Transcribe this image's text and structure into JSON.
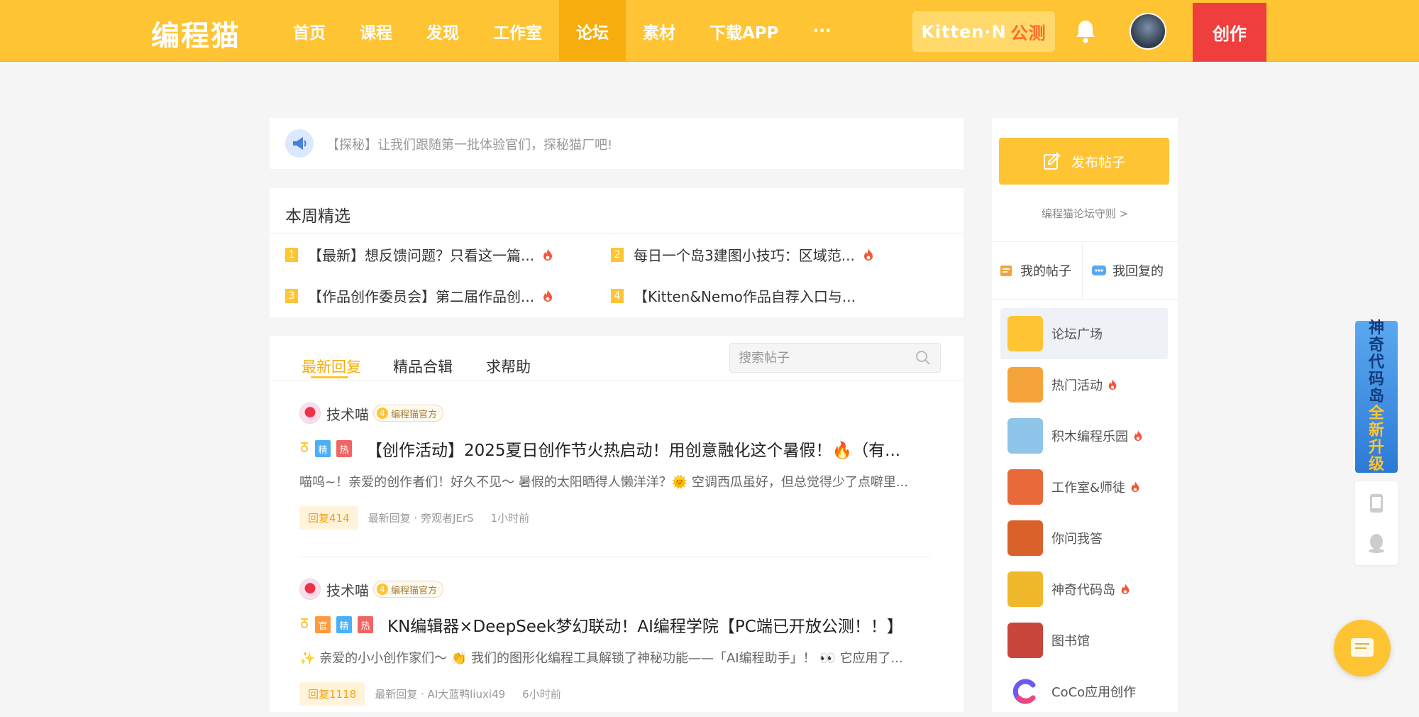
{
  "header": {
    "logo": "编程猫",
    "nav": [
      {
        "label": "首页",
        "active": false
      },
      {
        "label": "课程",
        "active": false
      },
      {
        "label": "发现",
        "active": false
      },
      {
        "label": "工作室",
        "active": false
      },
      {
        "label": "论坛",
        "active": true
      },
      {
        "label": "素材",
        "active": false
      },
      {
        "label": "下载APP",
        "active": false
      },
      {
        "label": "···",
        "active": false
      }
    ],
    "kitten_label": "Kitten·N",
    "kitten_suffix": "公测",
    "create_label": "创作",
    "brand_color": "#fec433",
    "create_color": "#ee3e3e"
  },
  "notice": {
    "text": "【探秘】让我们跟随第一批体验官们，探秘猫厂吧!"
  },
  "weekly": {
    "title": "本周精选",
    "items": [
      {
        "num": "1",
        "text": "【最新】想反馈问题？只看这一篇...",
        "hot": true
      },
      {
        "num": "2",
        "text": "每日一个岛3建图小技巧：区域范...",
        "hot": true
      },
      {
        "num": "3",
        "text": "【作品创作委员会】第二届作品创...",
        "hot": true
      },
      {
        "num": "4",
        "text": "【Kitten&Nemo作品自荐入口与...",
        "hot": false
      }
    ]
  },
  "feed": {
    "tabs": [
      {
        "label": "最新回复",
        "active": true
      },
      {
        "label": "精品合辑",
        "active": false
      },
      {
        "label": "求帮助",
        "active": false
      }
    ],
    "search_placeholder": "搜索帖子",
    "posts": [
      {
        "author": "技术喵",
        "level": "4",
        "badge": "编程猫官方",
        "tags": [
          {
            "label": "精",
            "kind": "jing"
          },
          {
            "label": "热",
            "kind": "re"
          }
        ],
        "title": "【创作活动】2025夏日创作节火热启动！用创意融化这个暑假！🔥（有...",
        "excerpt": "喵呜~！亲爱的创作者们！好久不见～ 暑假的太阳晒得人懒洋洋？🌞 空调西瓜虽好，但总觉得少了点噼里...",
        "reply": "回复414",
        "last_reply": "最新回复 · 旁观者JErS",
        "time": "1小时前"
      },
      {
        "author": "技术喵",
        "level": "4",
        "badge": "编程猫官方",
        "tags": [
          {
            "label": "官",
            "kind": "guan"
          },
          {
            "label": "精",
            "kind": "jing"
          },
          {
            "label": "热",
            "kind": "re"
          }
        ],
        "title": "KN编辑器×DeepSeek梦幻联动！AI编程学院【PC端已开放公测！！】",
        "excerpt": "✨ 亲爱的小小创作家们～ 👏 我们的图形化编程工具解锁了神秘功能——「AI编程助手」！ 👀 它应用了...",
        "reply": "回复1118",
        "last_reply": "最新回复 · AI大蓝鸭liuxi49",
        "time": "6小时前"
      }
    ]
  },
  "sidebar": {
    "publish_label": "发布帖子",
    "rules_label": "编程猫论坛守则 >",
    "my_posts": "我的帖子",
    "my_replies": "我回复的",
    "forums": [
      {
        "label": "论坛广场",
        "hot": false,
        "active": true,
        "color": "#fec433"
      },
      {
        "label": "热门活动",
        "hot": true,
        "active": false,
        "color": "#f5a33b"
      },
      {
        "label": "积木编程乐园",
        "hot": true,
        "active": false,
        "color": "#8ec5e8"
      },
      {
        "label": "工作室&师徒",
        "hot": true,
        "active": false,
        "color": "#e86a3a"
      },
      {
        "label": "你问我答",
        "hot": false,
        "active": false,
        "color": "#d9622b"
      },
      {
        "label": "神奇代码岛",
        "hot": true,
        "active": false,
        "color": "#f0b82b"
      },
      {
        "label": "图书馆",
        "hot": false,
        "active": false,
        "color": "#c9463a"
      },
      {
        "label": "CoCo应用创作",
        "hot": false,
        "active": false,
        "color": "#6a5af0"
      }
    ]
  },
  "float_banner": {
    "chars": [
      "神",
      "奇",
      "代",
      "码",
      "岛",
      "全",
      "新",
      "升",
      "级"
    ]
  }
}
